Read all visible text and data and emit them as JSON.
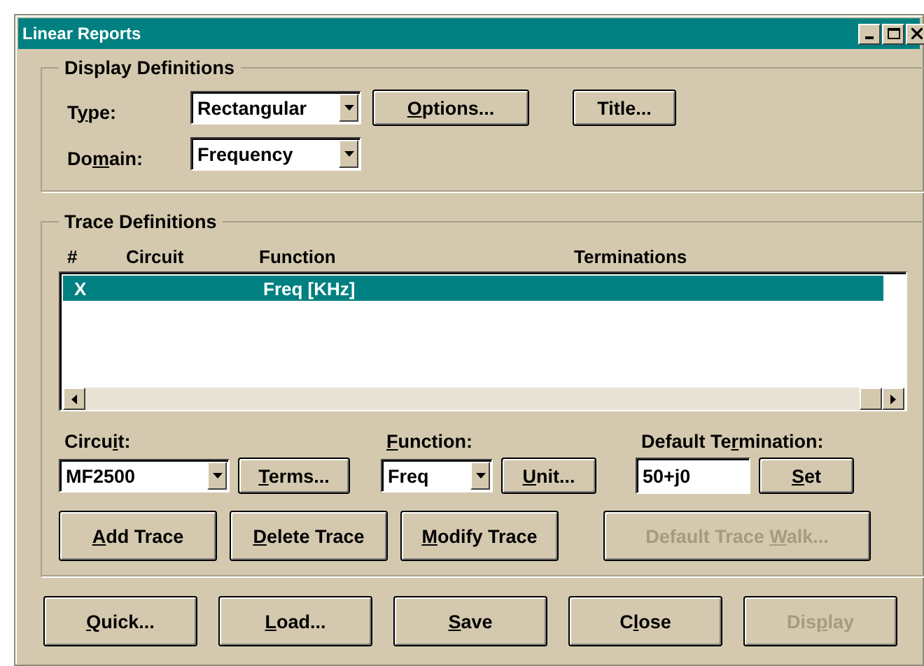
{
  "window": {
    "title": "Linear Reports"
  },
  "display_definitions": {
    "legend": "Display Definitions",
    "type": {
      "label": {
        "pre": "T",
        "key": "y",
        "post": "pe:"
      },
      "value": "Rectangular"
    },
    "domain": {
      "label": {
        "pre": "Do",
        "key": "m",
        "post": "ain:"
      },
      "value": "Frequency"
    },
    "options_button": {
      "label": {
        "key": "O",
        "post": "ptions..."
      },
      "disabled": false
    },
    "title_button": {
      "label": {
        "pre": "Title..."
      },
      "disabled": false
    }
  },
  "trace_definitions": {
    "legend": "Trace Definitions",
    "columns": [
      "#",
      "Circuit",
      "Function",
      "Terminations"
    ],
    "rows": [
      {
        "cells": [
          "X",
          null,
          "Freq [KHz]",
          null
        ],
        "selected": true
      }
    ],
    "circuit": {
      "label": {
        "pre": "Circu",
        "key": "i",
        "post": "t:"
      },
      "value": "MF2500"
    },
    "terms_button": {
      "label": {
        "key": "T",
        "post": "erms..."
      },
      "disabled": false
    },
    "function": {
      "label": {
        "key": "F",
        "post": "unction:"
      },
      "value": "Freq"
    },
    "unit_button": {
      "label": {
        "key": "U",
        "post": "nit..."
      },
      "disabled": false
    },
    "default_termination": {
      "label": {
        "pre": "Default Te",
        "key": "r",
        "post": "mination:"
      },
      "value": "50+j0"
    },
    "set_button": {
      "label": {
        "key": "S",
        "post": "et"
      },
      "disabled": false
    },
    "actions": [
      {
        "label": {
          "key": "A",
          "post": "dd Trace"
        },
        "disabled": false
      },
      {
        "label": {
          "key": "D",
          "post": "elete Trace"
        },
        "disabled": false
      },
      {
        "label": {
          "key": "M",
          "post": "odify Trace"
        },
        "disabled": false
      },
      {
        "label": {
          "pre": "Default Trace ",
          "key": "W",
          "post": "alk..."
        },
        "disabled": true
      }
    ]
  },
  "buttons": [
    {
      "label": {
        "key": "Q",
        "post": "uick..."
      },
      "disabled": false
    },
    {
      "label": {
        "key": "L",
        "post": "oad..."
      },
      "disabled": false
    },
    {
      "label": {
        "key": "S",
        "post": "ave"
      },
      "disabled": false
    },
    {
      "label": {
        "pre": "C",
        "key": "l",
        "post": "ose"
      },
      "disabled": false
    },
    {
      "label": {
        "pre": "Dis",
        "key": "p",
        "post": "lay"
      },
      "disabled": true
    }
  ]
}
